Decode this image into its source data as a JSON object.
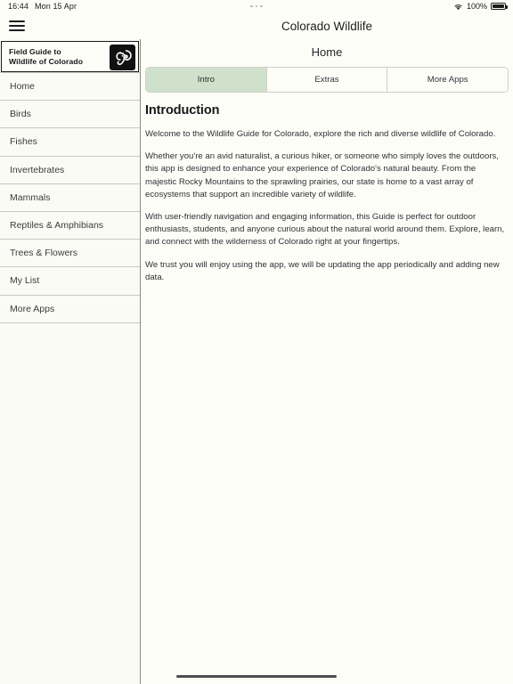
{
  "status_bar": {
    "time": "16:44",
    "date": "Mon 15 Apr",
    "battery_percent": "100%",
    "wifi_icon": "wifi-icon",
    "battery_icon": "battery-full-icon",
    "multitask_indicator": "three-dots-icon"
  },
  "nav": {
    "menu_icon": "hamburger-menu-icon",
    "title": "Colorado Wildlife"
  },
  "sidebar": {
    "header": {
      "line1": "Field Guide to",
      "line2": "Wildlife of Colorado",
      "logo_icon": "bighorn-sheep-logo-icon"
    },
    "items": [
      {
        "label": "Home",
        "active": true
      },
      {
        "label": "Birds",
        "active": false
      },
      {
        "label": "Fishes",
        "active": false
      },
      {
        "label": "Invertebrates",
        "active": false
      },
      {
        "label": "Mammals",
        "active": false
      },
      {
        "label": "Reptiles & Amphibians",
        "active": false
      },
      {
        "label": "Trees & Flowers",
        "active": false
      },
      {
        "label": "My List",
        "active": false
      },
      {
        "label": "More Apps",
        "active": false
      }
    ]
  },
  "main": {
    "page_title": "Home",
    "tabs": [
      {
        "label": "Intro",
        "selected": true
      },
      {
        "label": "Extras",
        "selected": false
      },
      {
        "label": "More Apps",
        "selected": false
      }
    ],
    "heading": "Introduction",
    "paragraphs": [
      "Welcome to the Wildlife Guide for Colorado,  explore the rich and diverse wildlife of Colorado.",
      "Whether you're an avid naturalist, a curious hiker, or someone who simply loves the outdoors, this app is designed to enhance your experience of Colorado's natural beauty. From the majestic Rocky Mountains to the sprawling prairies, our state is home to a vast array of ecosystems that support an incredible variety of wildlife.",
      "With user-friendly navigation and engaging information, this Guide is perfect for outdoor enthusiasts, students, and anyone curious about the natural world around them. Explore, learn, and connect with the wilderness of Colorado right at your fingertips.",
      "We trust you will enjoy using the app, we will be updating the app periodically and adding new data."
    ]
  },
  "colors": {
    "page_background": "#fdfdf8",
    "sidebar_background": "#fbfbf6",
    "selected_tab": "#cfe0cb",
    "divider": "#c9c9c4",
    "text": "#303034"
  },
  "home_indicator": "home-indicator-bar"
}
